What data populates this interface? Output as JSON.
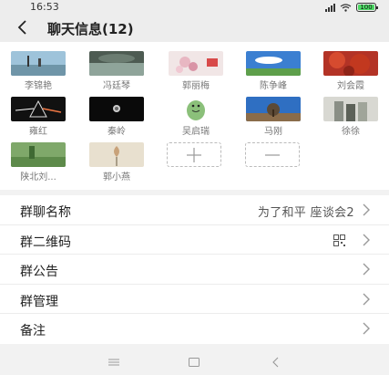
{
  "status": {
    "time": "16:53",
    "battery": "100"
  },
  "header": {
    "title": "聊天信息(12)"
  },
  "members": [
    {
      "name": "李锦艳",
      "avatar": "lake-photo"
    },
    {
      "name": "冯廷琴",
      "avatar": "river-photo"
    },
    {
      "name": "郭丽梅",
      "avatar": "blossom-photo"
    },
    {
      "name": "陈争峰",
      "avatar": "sky-photo"
    },
    {
      "name": "刘会霞",
      "avatar": "autumn-photo"
    },
    {
      "name": "雍红",
      "avatar": "prism-photo"
    },
    {
      "name": "秦岭",
      "avatar": "dark-photo"
    },
    {
      "name": "吴启瑞",
      "avatar": "dinosaur-cartoon"
    },
    {
      "name": "马刚",
      "avatar": "tree-photo"
    },
    {
      "name": "徐徐",
      "avatar": "people-photo"
    },
    {
      "name": "陕北刘...",
      "avatar": "field-photo"
    },
    {
      "name": "郭小燕",
      "avatar": "flower-drawing"
    }
  ],
  "settings": [
    {
      "label": "群聊名称",
      "value": "为了和平 座谈会2"
    },
    {
      "label": "群二维码",
      "value": ""
    },
    {
      "label": "群公告",
      "value": ""
    },
    {
      "label": "群管理",
      "value": ""
    },
    {
      "label": "备注",
      "value": ""
    }
  ]
}
